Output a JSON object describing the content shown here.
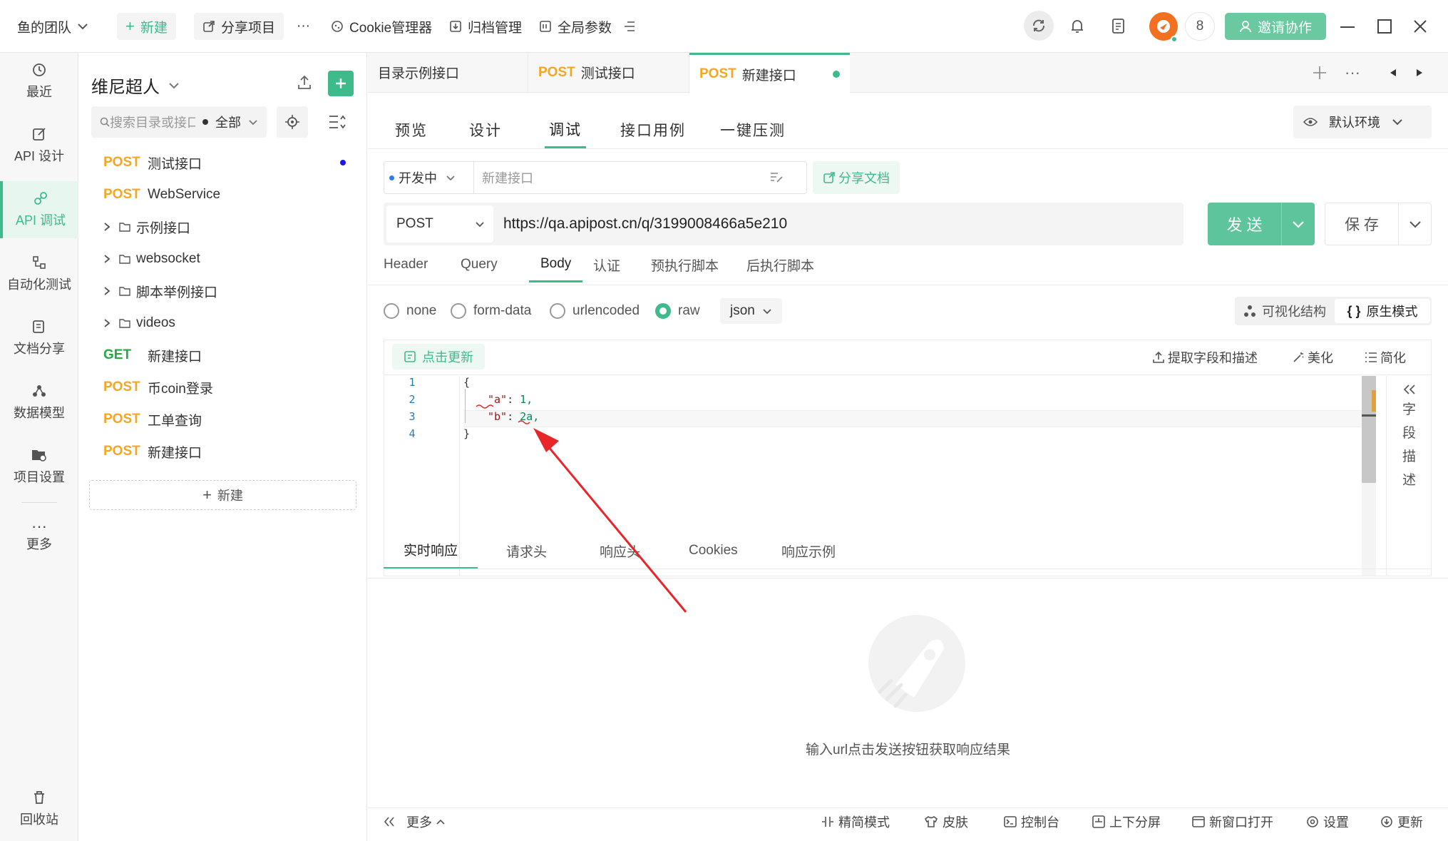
{
  "topbar": {
    "team": "鱼的团队",
    "new_label": "新建",
    "share_project": "分享项目",
    "more": "···",
    "cookie_manager": "Cookie管理器",
    "archive": "归档管理",
    "global_params": "全局参数",
    "badge_count": "8",
    "invite": "邀请协作"
  },
  "nav": {
    "recent": "最近",
    "api_design": "API 设计",
    "api_debug": "API 调试",
    "auto_test": "自动化测试",
    "doc_share": "文档分享",
    "data_model": "数据模型",
    "project_settings": "项目设置",
    "more": "更多",
    "recycle": "回收站"
  },
  "tree": {
    "project": "维尼超人",
    "search_placeholder": "搜索目录或接口",
    "filter": "全部",
    "new_label": "新建",
    "items": [
      {
        "method": "POST",
        "name": "测试接口"
      },
      {
        "method": "POST",
        "name": "WebService"
      },
      {
        "folder": "示例接口"
      },
      {
        "folder": "websocket"
      },
      {
        "folder": "脚本举例接口"
      },
      {
        "folder": "videos"
      },
      {
        "method": "GET",
        "name": "新建接口"
      },
      {
        "method": "POST",
        "name": "币coin登录"
      },
      {
        "method": "POST",
        "name": "工单查询"
      },
      {
        "method": "POST",
        "name": "新建接口"
      }
    ]
  },
  "tabs": [
    {
      "label": "目录示例接口"
    },
    {
      "method": "POST",
      "label": "测试接口"
    },
    {
      "method": "POST",
      "label": "新建接口"
    }
  ],
  "subtabs": [
    "预览",
    "设计",
    "调试",
    "接口用例",
    "一键压测"
  ],
  "env": "默认环境",
  "status": "开发中",
  "api_name_placeholder": "新建接口",
  "share_doc": "分享文档",
  "request": {
    "method": "POST",
    "url": "https://qa.apipost.cn/q/3199008466a5e210",
    "send": "发 送",
    "save": "保 存"
  },
  "body_tabs": [
    "Header",
    "Query",
    "Body",
    "认证",
    "预执行脚本",
    "后执行脚本"
  ],
  "body_types": [
    "none",
    "form-data",
    "urlencoded",
    "raw"
  ],
  "body_format": "json",
  "view_modes": {
    "visual": "可视化结构",
    "raw": "原生模式"
  },
  "editor_toolbar": {
    "refresh": "点击更新",
    "extract": "提取字段和描述",
    "beautify": "美化",
    "simplify": "简化",
    "field_desc": [
      "字",
      "段",
      "描",
      "述"
    ]
  },
  "code": [
    {
      "n": "1",
      "t": "{"
    },
    {
      "n": "2",
      "key": "\"a\"",
      "val": "1,"
    },
    {
      "n": "3",
      "key": "\"b\"",
      "val": "2a,"
    },
    {
      "n": "4",
      "t": "}"
    }
  ],
  "resp_tabs": [
    "实时响应",
    "请求头",
    "响应头",
    "Cookies",
    "响应示例"
  ],
  "empty_hint": "输入url点击发送按钮获取响应结果",
  "footer": {
    "more": "更多",
    "simple_mode": "精简模式",
    "skin": "皮肤",
    "console": "控制台",
    "split": "上下分屏",
    "new_window": "新窗口打开",
    "settings": "设置",
    "update": "更新"
  },
  "colors": {
    "accent": "#3fba8b",
    "post": "#f5a623",
    "get": "#28a745",
    "arrow": "#e8262a"
  }
}
